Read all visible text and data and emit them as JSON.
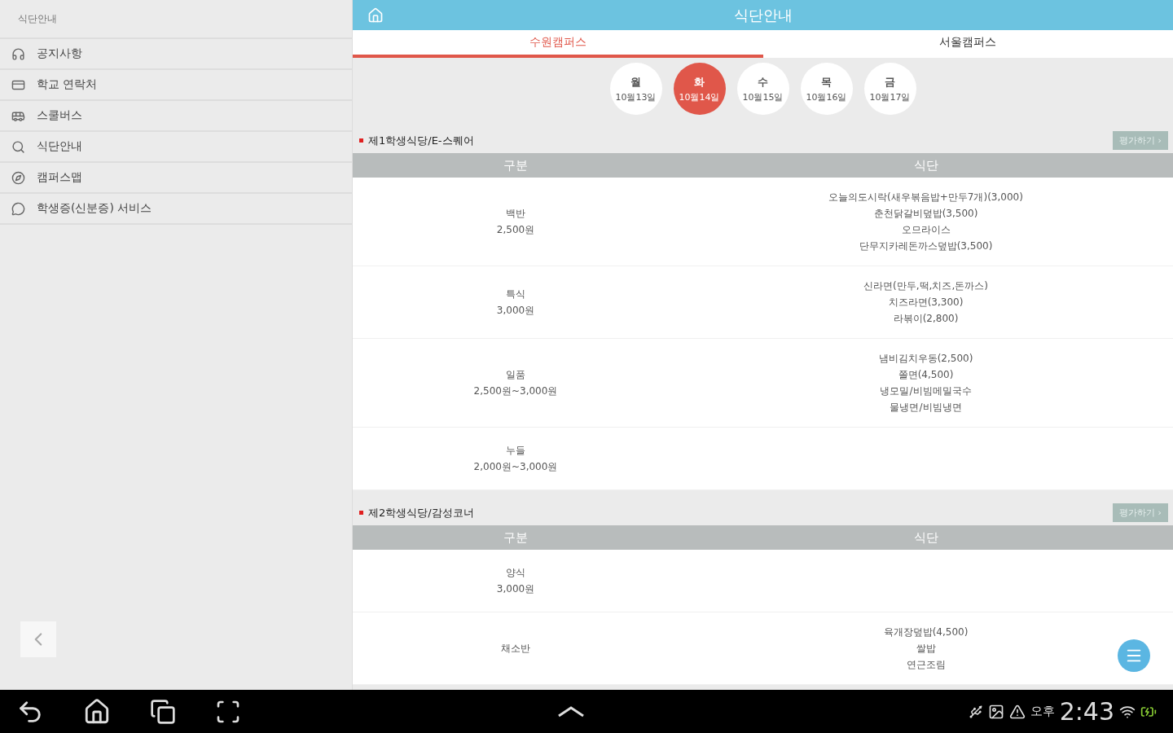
{
  "sidebar": {
    "title": "식단안내",
    "items": [
      {
        "label": "공지사항"
      },
      {
        "label": "학교 연락처"
      },
      {
        "label": "스쿨버스"
      },
      {
        "label": "식단안내"
      },
      {
        "label": "캠퍼스맵"
      },
      {
        "label": "학생증(신분증) 서비스"
      }
    ]
  },
  "header": {
    "title": "식단안내"
  },
  "tabs": [
    {
      "label": "수원캠퍼스",
      "selected": true
    },
    {
      "label": "서울캠퍼스",
      "selected": false
    }
  ],
  "days": [
    {
      "day": "월",
      "date": "10월13일",
      "selected": false
    },
    {
      "day": "화",
      "date": "10월14일",
      "selected": true
    },
    {
      "day": "수",
      "date": "10월15일",
      "selected": false
    },
    {
      "day": "목",
      "date": "10월16일",
      "selected": false
    },
    {
      "day": "금",
      "date": "10월17일",
      "selected": false
    }
  ],
  "sections": [
    {
      "title": "제1학생식당/E-스퀘어",
      "button": "평가하기 ›",
      "columns": [
        "구분",
        "식단"
      ],
      "rows": [
        {
          "name": "백반",
          "price": "2,500원",
          "menu": [
            "오늘의도시락(새우볶음밥+만두7개)(3,000)",
            "춘천닭갈비덮밥(3,500)",
            "오므라이스",
            "단무지카레돈까스덮밥(3,500)"
          ]
        },
        {
          "name": "특식",
          "price": "3,000원",
          "menu": [
            "신라면(만두,떡,치즈,돈까스)",
            "치즈라면(3,300)",
            "라볶이(2,800)"
          ]
        },
        {
          "name": "일품",
          "price": "2,500원~3,000원",
          "menu": [
            "냄비김치우동(2,500)",
            "쫄면(4,500)",
            "냉모밀/비빔메밀국수",
            "물냉면/비빔냉면"
          ]
        },
        {
          "name": "누들",
          "price": "2,000원~3,000원",
          "menu": []
        }
      ]
    },
    {
      "title": "제2학생식당/감성코너",
      "button": "평가하기 ›",
      "columns": [
        "구분",
        "식단"
      ],
      "rows": [
        {
          "name": "양식",
          "price": "3,000원",
          "menu": []
        },
        {
          "name": "채소반",
          "price": "",
          "menu": [
            "육개장덮밥(4,500)",
            "쌀밥",
            "연근조림"
          ]
        }
      ]
    }
  ],
  "status_bar": {
    "ampm": "오후",
    "time": "2:43"
  }
}
